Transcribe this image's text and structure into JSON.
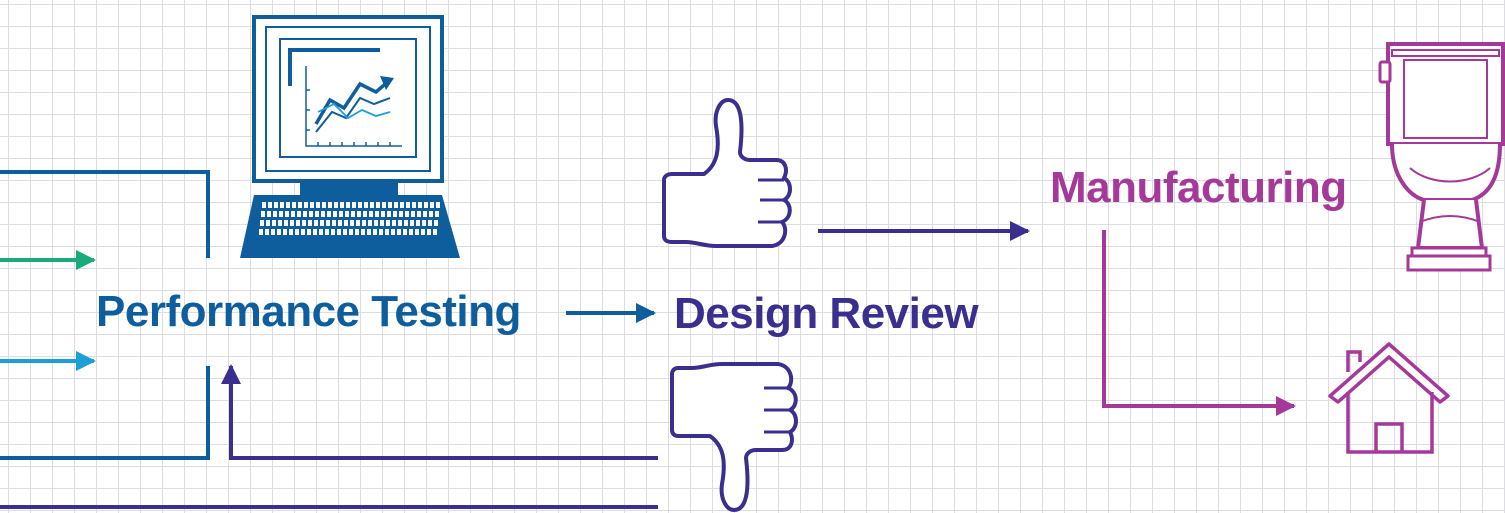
{
  "stages": {
    "performance_testing": "Performance Testing",
    "design_review": "Design Review",
    "manufacturing": "Manufacturing"
  },
  "icons": {
    "testing": "computer-monitor-chart-icon",
    "approve": "thumbs-up-icon",
    "reject": "thumbs-down-icon",
    "product": "toilet-icon",
    "destination": "house-icon"
  },
  "colors": {
    "testing": "#0e5e9e",
    "input_green": "#1aab7c",
    "input_cyan": "#1d9ed4",
    "review": "#3a2f8f",
    "manufacturing": "#a5399a",
    "grid": "#dcdce2"
  }
}
